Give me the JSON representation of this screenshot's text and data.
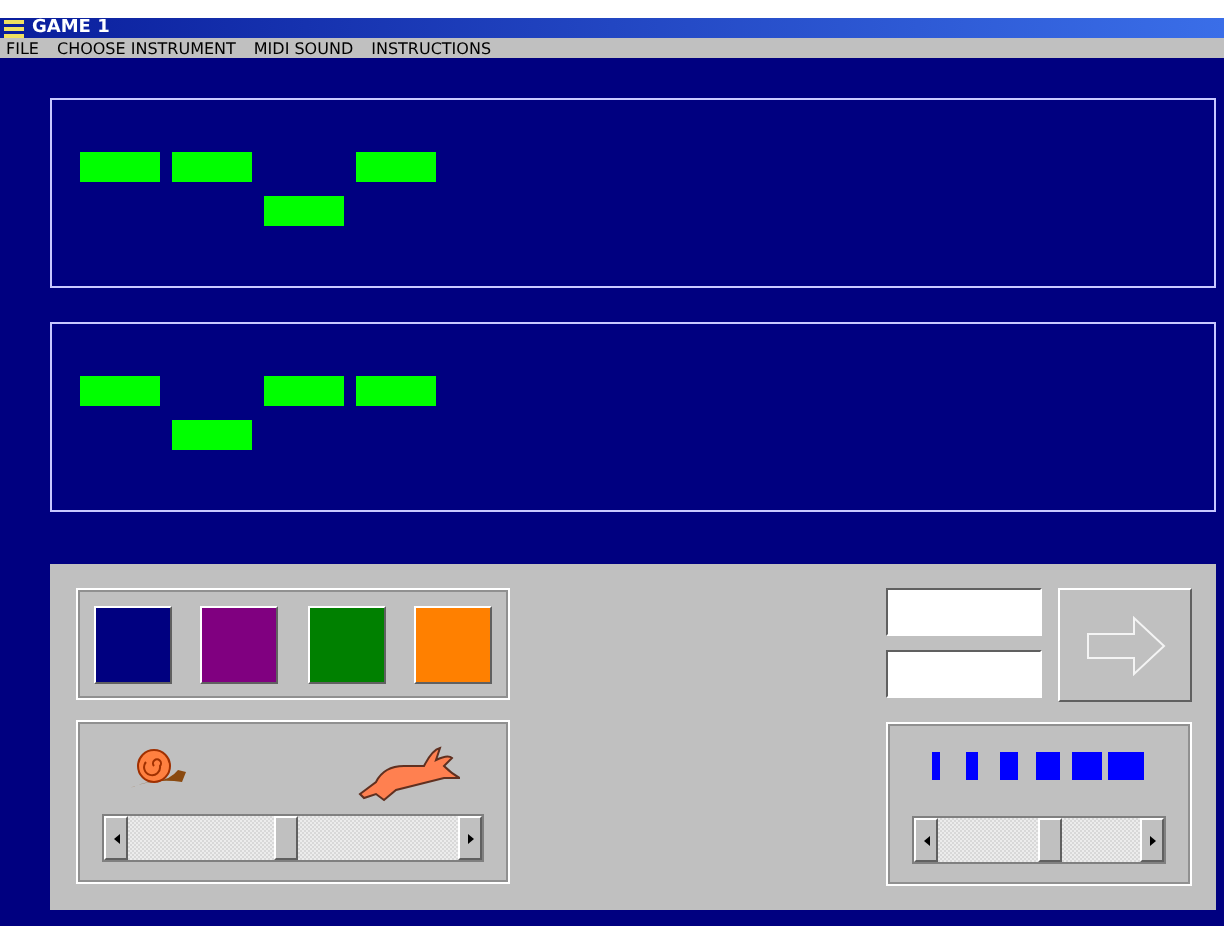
{
  "window": {
    "title": "GAME 1"
  },
  "menu": [
    "FILE",
    "CHOOSE INSTRUMENT",
    "MIDI SOUND",
    "INSTRUCTIONS"
  ],
  "staves": [
    {
      "notes": [
        {
          "kind": "upper"
        },
        {
          "kind": "upper"
        },
        {
          "kind": "lower"
        },
        {
          "kind": "upper"
        }
      ]
    },
    {
      "notes": [
        {
          "kind": "upper"
        },
        {
          "kind": "lower"
        },
        {
          "kind": "upper"
        },
        {
          "kind": "upper"
        }
      ]
    }
  ],
  "swatches": [
    {
      "color": "#000080"
    },
    {
      "color": "#800080"
    },
    {
      "color": "#008000"
    },
    {
      "color": "#ff8000"
    }
  ],
  "speed": {
    "level": 0.48
  },
  "volume": {
    "level": 0.55
  }
}
